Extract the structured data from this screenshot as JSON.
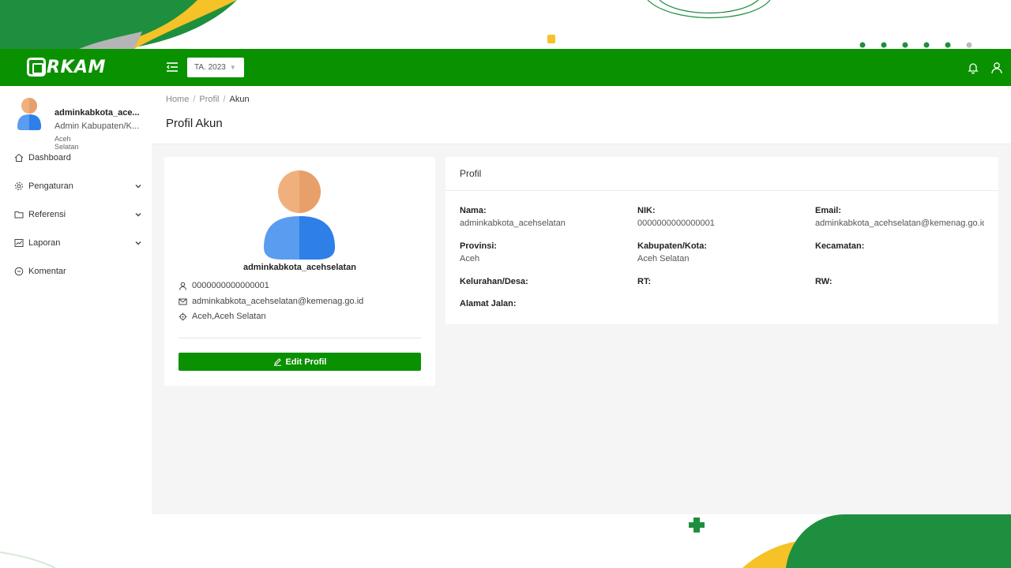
{
  "navbar": {
    "logo_text": "RKAM",
    "year_select": "TA. 2023"
  },
  "sidebar": {
    "user": {
      "name": "adminkabkota_ace...",
      "role": "Admin Kabupaten/K...",
      "region": "Aceh Selatan"
    },
    "items": [
      {
        "label": "Dashboard",
        "icon": "home-icon",
        "has_children": false
      },
      {
        "label": "Pengaturan",
        "icon": "gear-icon",
        "has_children": true
      },
      {
        "label": "Referensi",
        "icon": "folder-icon",
        "has_children": true
      },
      {
        "label": "Laporan",
        "icon": "chart-icon",
        "has_children": true
      },
      {
        "label": "Komentar",
        "icon": "comment-icon",
        "has_children": false
      }
    ]
  },
  "breadcrumb": {
    "items": [
      "Home",
      "Profil",
      "Akun"
    ],
    "separator": "/"
  },
  "page_title": "Profil Akun",
  "profile_card": {
    "username": "adminkabkota_acehselatan",
    "nik": "0000000000000001",
    "email": "adminkabkota_acehselatan@kemenag.go.id",
    "location": "Aceh,Aceh Selatan",
    "edit_button": "Edit Profil"
  },
  "detail_card": {
    "title": "Profil",
    "fields": {
      "nama": {
        "label": "Nama:",
        "value": "adminkabkota_acehselatan"
      },
      "nik": {
        "label": "NIK:",
        "value": "0000000000000001"
      },
      "email": {
        "label": "Email:",
        "value": "adminkabkota_acehselatan@kemenag.go.id"
      },
      "provinsi": {
        "label": "Provinsi:",
        "value": "Aceh"
      },
      "kabupaten": {
        "label": "Kabupaten/Kota:",
        "value": "Aceh Selatan"
      },
      "kecamatan": {
        "label": "Kecamatan:",
        "value": ""
      },
      "kelurahan": {
        "label": "Kelurahan/Desa:",
        "value": ""
      },
      "rt": {
        "label": "RT:",
        "value": ""
      },
      "rw": {
        "label": "RW:",
        "value": ""
      },
      "alamat": {
        "label": "Alamat Jalan:",
        "value": ""
      }
    }
  },
  "colors": {
    "primary": "#0a9100",
    "accent_yellow": "#f5c227",
    "accent_green_dark": "#1e8f3e"
  }
}
